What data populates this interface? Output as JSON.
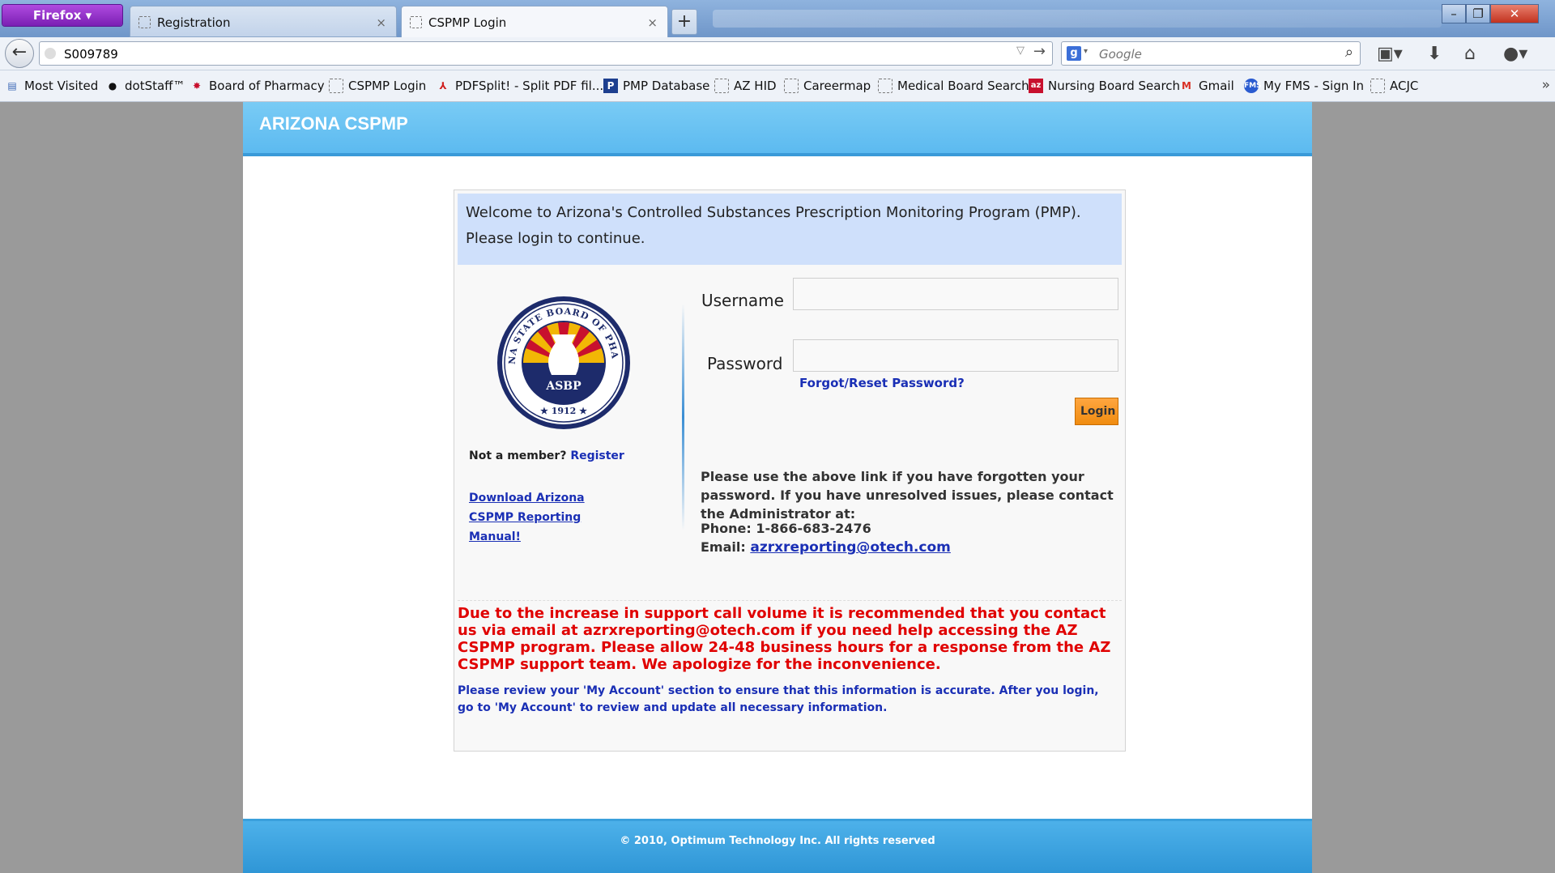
{
  "browser": {
    "menu_label": "Firefox",
    "tabs": [
      {
        "label": "Registration",
        "active": false
      },
      {
        "label": "CSPMP Login",
        "active": true
      }
    ],
    "new_tab_symbol": "+",
    "url": "S009789",
    "search_placeholder": "Google",
    "bookmarks": [
      {
        "label": "Most Visited",
        "icon": "most-visited-icon"
      },
      {
        "label": "dotStaff™",
        "icon": "dotstaff-icon"
      },
      {
        "label": "Board of Pharmacy",
        "icon": "arizona-flag-icon"
      },
      {
        "label": "CSPMP Login",
        "icon": "page-icon"
      },
      {
        "label": "PDFSplit! - Split PDF fil...",
        "icon": "pdf-icon"
      },
      {
        "label": "PMP Database",
        "icon": "pmp-icon"
      },
      {
        "label": "AZ HID",
        "icon": "page-icon"
      },
      {
        "label": "Careermap",
        "icon": "page-icon"
      },
      {
        "label": "Medical Board Search",
        "icon": "page-icon"
      },
      {
        "label": "Nursing Board Search",
        "icon": "az-icon"
      },
      {
        "label": "Gmail",
        "icon": "gmail-icon"
      },
      {
        "label": "My FMS - Sign In",
        "icon": "fms-icon"
      },
      {
        "label": "ACJC",
        "icon": "page-icon"
      }
    ]
  },
  "page": {
    "brand": "ARIZONA CSPMP",
    "welcome": "Welcome to Arizona's Controlled Substances Prescription Monitoring Program (PMP). Please login to continue.",
    "seal": {
      "top_text": "ARIZONA STATE BOARD OF PHARMACY",
      "center_text": "ASBP",
      "year": "1912"
    },
    "not_member": "Not a member?",
    "register": "Register",
    "manual_link": "Download Arizona CSPMP Reporting Manual!",
    "username_label": "Username",
    "password_label": "Password",
    "forgot_link": "Forgot/Reset Password?",
    "login_button": "Login",
    "help_text": "Please use the above link if you have forgotten your password. If you have unresolved issues, please contact the Administrator at:",
    "phone": "Phone: 1-866-683-2476",
    "email_label": "Email:",
    "email": "azrxreporting@otech.com",
    "warning": "Due to the increase in support call volume it is recommended that you contact us via email at azrxreporting@otech.com if you need help accessing the AZ CSPMP program. Please allow 24-48 business hours for a response from the AZ CSPMP support team. We apologize for the inconvenience.",
    "review": "Please review your 'My Account' section to ensure that this information is accurate. After you login, go to 'My Account' to review and update all necessary information.",
    "footer": "© 2010, Optimum Technology Inc. All rights reserved"
  },
  "colors": {
    "header_blue": "#5cbaf0",
    "welcome_bg": "#cfe0fb",
    "link_blue": "#1a2fb5",
    "warning_red": "#e00000",
    "login_orange": "#f08c10"
  }
}
